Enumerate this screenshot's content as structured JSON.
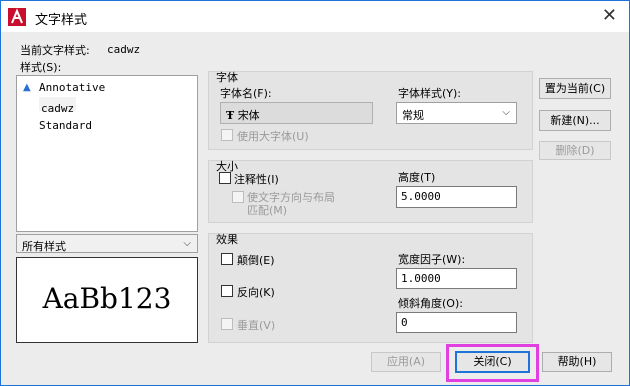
{
  "window": {
    "title": "文字样式",
    "close": "✕"
  },
  "current_style": {
    "label": "当前文字样式:",
    "value": "cadwz"
  },
  "styles": {
    "label": "样式(S):",
    "items": [
      {
        "name": "Annotative",
        "annotative": true,
        "selected": false
      },
      {
        "name": "cadwz",
        "annotative": false,
        "selected": true
      },
      {
        "name": "Standard",
        "annotative": false,
        "selected": false
      }
    ]
  },
  "filter": {
    "value": "所有样式"
  },
  "preview": {
    "text": "AaBb123"
  },
  "font": {
    "group_label": "字体",
    "name_label": "字体名(F):",
    "name_icon": "truetype-icon",
    "name_value": "宋体",
    "style_label": "字体样式(Y):",
    "style_value": "常规",
    "bigfont_label": "使用大字体(U)"
  },
  "size": {
    "group_label": "大小",
    "annotative_label": "注释性(I)",
    "match_label_line1": "使文字方向与布局",
    "match_label_line2": "匹配(M)",
    "height_label": "高度(T)",
    "height_value": "5.0000"
  },
  "effects": {
    "group_label": "效果",
    "upside_down_label": "颠倒(E)",
    "backwards_label": "反向(K)",
    "vertical_label": "垂直(V)",
    "width_label": "宽度因子(W):",
    "width_value": "1.0000",
    "oblique_label": "倾斜角度(O):",
    "oblique_value": "0"
  },
  "buttons": {
    "set_current": "置为当前(C)",
    "new": "新建(N)...",
    "delete": "删除(D)",
    "apply": "应用(A)",
    "close": "关闭(C)",
    "help": "帮助(H)"
  },
  "colors": {
    "highlight": "#e040e0",
    "accent": "#1e73d8",
    "app_icon": "#c8102e"
  }
}
